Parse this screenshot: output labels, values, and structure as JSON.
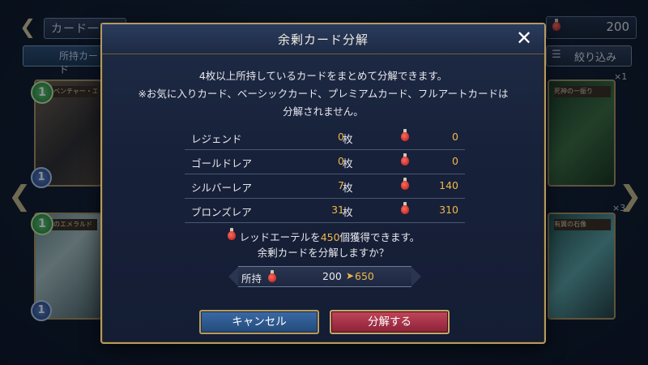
{
  "background": {
    "header_title": "カード一覧",
    "currency_value": "200",
    "tab_owned_label": "所持カード",
    "filter_label": "絞り込み",
    "cards": [
      {
        "name": "アドベンチャー・エルフ",
        "count": "×1",
        "cost": "1",
        "atk": "1"
      },
      {
        "name": "神秘のエメラルド",
        "count": "×1",
        "cost": "1",
        "atk": "1"
      },
      {
        "name": "死神の一振り",
        "count": "×1"
      },
      {
        "name": "有翼の石像",
        "count": "×3"
      }
    ]
  },
  "modal": {
    "title": "余剰カード分解",
    "description_line1": "4枚以上所持しているカードをまとめて分解できます。",
    "description_line2": "※お気に入りカード、ベーシックカード、プレミアムカード、フルアートカードは",
    "description_line3": "分解されません。",
    "rows": [
      {
        "label": "レジェンド",
        "qty": "0",
        "unit": "枚",
        "ether": "0"
      },
      {
        "label": "ゴールドレア",
        "qty": "0",
        "unit": "枚",
        "ether": "0"
      },
      {
        "label": "シルバーレア",
        "qty": "7",
        "unit": "枚",
        "ether": "140"
      },
      {
        "label": "ブロンズレア",
        "qty": "31",
        "unit": "枚",
        "ether": "310"
      }
    ],
    "gain_prefix": "レッドエーテルを",
    "gain_amount": "450",
    "gain_suffix": "個獲得できます。",
    "confirm_text": "余剰カードを分解しますか？",
    "owned_label": "所持",
    "owned_current": "200",
    "owned_after": "650",
    "cancel_label": "キャンセル",
    "ok_label": "分解する"
  },
  "colors": {
    "accent_gold": "#f0b84a",
    "frame_gold": "#b49a62",
    "cancel_blue": "#2f5d96",
    "ok_red": "#a8344a"
  },
  "icons": [
    "back-arrow-icon",
    "red-ether-icon",
    "filter-icon",
    "close-icon",
    "left-arrow-icon",
    "right-arrow-icon"
  ]
}
